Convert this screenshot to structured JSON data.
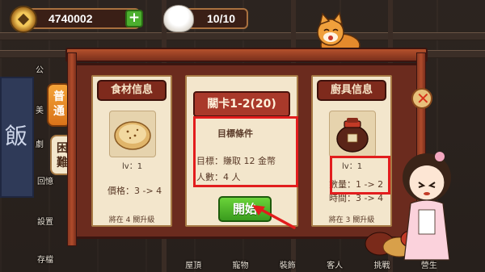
{
  "hud": {
    "coins": "4740002",
    "plus_label": "+",
    "buns": "10/10"
  },
  "mode_tabs": {
    "normal": "普通",
    "hard": "困難"
  },
  "side_menu": [
    "公",
    "美",
    "劇",
    "回憶",
    "設置",
    "存檔"
  ],
  "bottom_nav": [
    "屋頂",
    "寵物",
    "裝飾",
    "客人",
    "挑戰",
    "營生"
  ],
  "ingredient_card": {
    "title": "食材信息",
    "level": "lv：1",
    "price": "價格：3 -> 4",
    "footer": "將在 4 關升級"
  },
  "stage_card": {
    "stage": "關卡1-2(20)",
    "goal_title": "目標條件",
    "goal_money": "目標：賺取 12 金幣",
    "goal_people": "人數：4 人",
    "start_label": "開始"
  },
  "tool_card": {
    "title": "廚具信息",
    "level": "lv：1",
    "quantity": "數量：1 -> 2",
    "time": "時間：3 -> 4",
    "footer": "將在 3 關升級"
  },
  "icons": {
    "coin": "coin-icon",
    "bun": "steamed-bun-icon",
    "close": "close-icon",
    "arrow": "arrow-pointer-icon"
  },
  "colors": {
    "panel_red": "#6b2b1e",
    "card_cream": "#f3e6cc",
    "highlight_red": "#e21d1d",
    "start_green": "#4caf2e",
    "tab_orange": "#f4a338"
  }
}
